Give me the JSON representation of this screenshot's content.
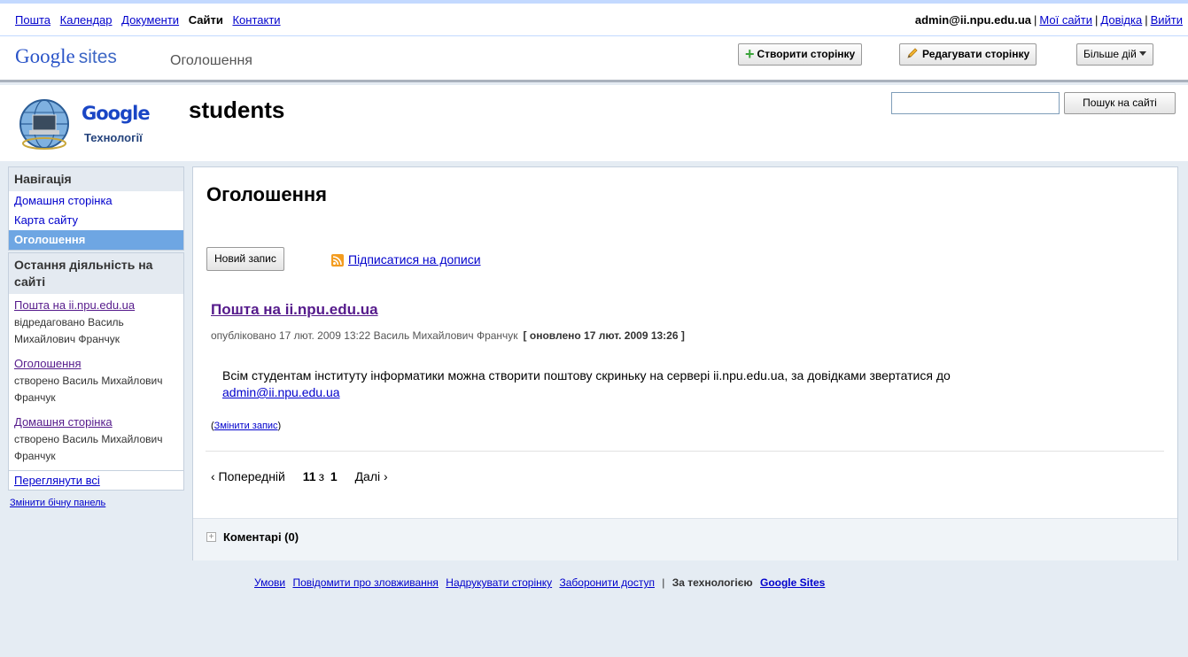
{
  "topbar": {
    "apps": [
      "Пошта",
      "Календар",
      "Документи",
      "Сайти",
      "Контакти"
    ],
    "account_email": "admin@ii.npu.edu.ua",
    "my_sites": "Мої сайти",
    "help": "Довідка",
    "signout": "Вийти"
  },
  "header": {
    "logo_google": "Google",
    "logo_sites": "sites",
    "page_name": "Оголошення",
    "create_page": "Створити сторінку",
    "edit_page": "Редагувати сторінку",
    "more_actions": "Більше дій"
  },
  "site": {
    "name": "students",
    "logo_word": "Google",
    "logo_sub": "Технології",
    "search_button": "Пошук на сайті",
    "search_value": ""
  },
  "sidebar": {
    "nav_title": "Навігація",
    "nav_items": [
      "Домашня сторінка",
      "Карта сайту",
      "Оголошення"
    ],
    "activity_title": "Остання діяльність на сайті",
    "activity": [
      {
        "link": "Пошта на ii.npu.edu.ua",
        "text": "відредаговано Василь Михайлович Франчук"
      },
      {
        "link": "Оголошення",
        "text": "створено Василь Михайлович Франчук"
      },
      {
        "link": "Домашня сторінка",
        "text": "створено Василь Михайлович Франчук"
      }
    ],
    "view_all": "Переглянути всі",
    "edit_sidebar": "Змінити бічну панель"
  },
  "main": {
    "title": "Оголошення",
    "new_post": "Новий запис",
    "subscribe": "Підписатися на дописи",
    "post": {
      "title": "Пошта на ii.npu.edu.ua",
      "meta": "опубліковано 17 лют. 2009 13:22 Василь Михайлович Франчук",
      "updated": "[ оновлено 17 лют. 2009 13:26 ]",
      "body": "Всім студентам інституту інформатики можна створити поштову скриньку на сервері ii.npu.edu.ua, за довідками звертатися до",
      "email": "admin@ii.npu.edu.ua",
      "edit": "Змінити запис"
    },
    "pager": {
      "prev": "‹ Попередній",
      "range": "11",
      "of": "з",
      "total": "1",
      "next": "Далі ›"
    },
    "comments": "Коментарі (0)"
  },
  "footer": {
    "terms": "Умови",
    "report": "Повідомити про зловживання",
    "print": "Надрукувати сторінку",
    "block": "Заборонити доступ",
    "powered": "За технологією",
    "google_sites": "Google Sites"
  }
}
